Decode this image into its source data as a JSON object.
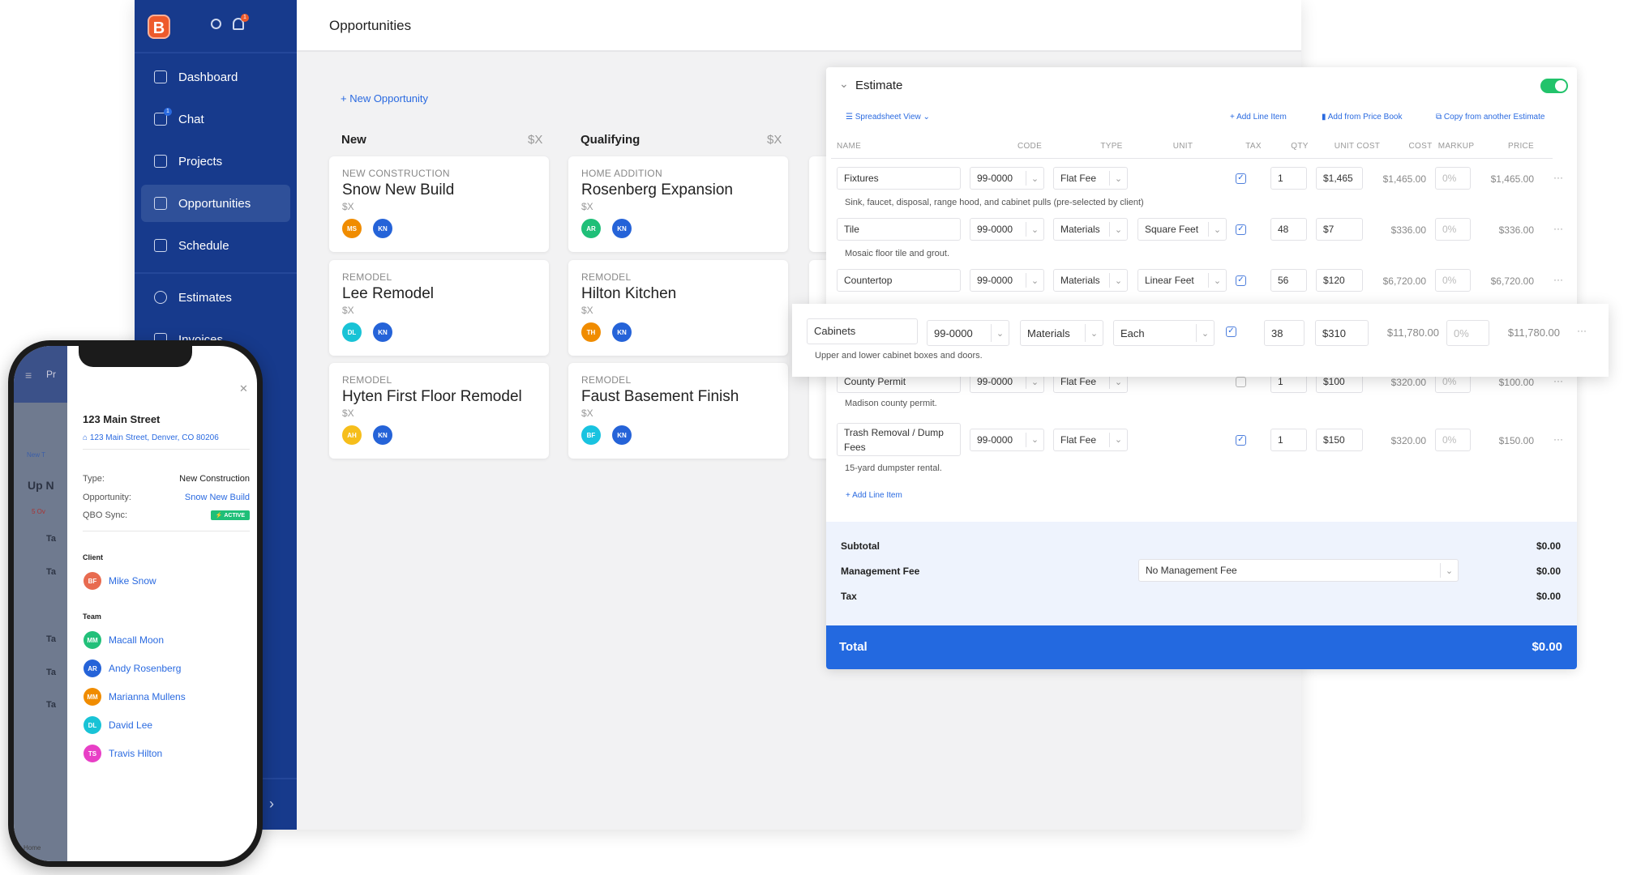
{
  "sidebar": {
    "logo": "B",
    "notif_count": "1",
    "chat_badge": "1",
    "items": [
      {
        "label": "Dashboard"
      },
      {
        "label": "Chat"
      },
      {
        "label": "Projects"
      },
      {
        "label": "Opportunities",
        "active": true
      },
      {
        "label": "Schedule"
      },
      {
        "label": "Estimates"
      },
      {
        "label": "Invoices"
      }
    ]
  },
  "header": {
    "title": "Opportunities"
  },
  "board": {
    "new_button": "+ New Opportunity",
    "columns": [
      {
        "title": "New",
        "sum": "$X",
        "cards": [
          {
            "category": "NEW CONSTRUCTION",
            "title": "Snow New Build",
            "amount": "$X",
            "avatars": [
              {
                "i": "MS",
                "c": "#f08c00"
              },
              {
                "i": "KN",
                "c": "#2563d8"
              }
            ]
          },
          {
            "category": "REMODEL",
            "title": "Lee Remodel",
            "amount": "$X",
            "avatars": [
              {
                "i": "DL",
                "c": "#19c3d6"
              },
              {
                "i": "KN",
                "c": "#2563d8"
              }
            ]
          },
          {
            "category": "REMODEL",
            "title": "Hyten First Floor Remodel",
            "amount": "$X",
            "avatars": [
              {
                "i": "AH",
                "c": "#f6be1b"
              },
              {
                "i": "KN",
                "c": "#2563d8"
              }
            ]
          }
        ]
      },
      {
        "title": "Qualifying",
        "sum": "$X",
        "cards": [
          {
            "category": "HOME ADDITION",
            "title": "Rosenberg Expansion",
            "amount": "$X",
            "avatars": [
              {
                "i": "AR",
                "c": "#1fbf78"
              },
              {
                "i": "KN",
                "c": "#2563d8"
              }
            ]
          },
          {
            "category": "REMODEL",
            "title": "Hilton Kitchen",
            "amount": "$X",
            "avatars": [
              {
                "i": "TH",
                "c": "#f08c00"
              },
              {
                "i": "KN",
                "c": "#2563d8"
              }
            ]
          },
          {
            "category": "REMODEL",
            "title": "Faust Basement Finish",
            "amount": "$X",
            "avatars": [
              {
                "i": "BF",
                "c": "#19c3e0"
              },
              {
                "i": "KN",
                "c": "#2563d8"
              }
            ]
          }
        ]
      }
    ]
  },
  "estimate": {
    "title": "Estimate",
    "toggle_on": true,
    "view": "Spreadsheet View",
    "add_line_item": "+ Add Line Item",
    "add_price_book": "Add from Price Book",
    "copy_estimate": "Copy from another Estimate",
    "headers": [
      "NAME",
      "CODE",
      "TYPE",
      "UNIT",
      "TAX",
      "QTY",
      "UNIT COST",
      "COST",
      "MARKUP",
      "PRICE"
    ],
    "rows": [
      {
        "name": "Fixtures",
        "code": "99-0000",
        "type": "Flat Fee",
        "unit": "",
        "tax": true,
        "qty": "1",
        "unit_cost": "$1,465",
        "cost": "$1,465.00",
        "markup": "0%",
        "price": "$1,465.00",
        "desc": "Sink, faucet, disposal, range hood, and cabinet pulls (pre-selected by client)"
      },
      {
        "name": "Tile",
        "code": "99-0000",
        "type": "Materials",
        "unit": "Square Feet",
        "tax": true,
        "qty": "48",
        "unit_cost": "$7",
        "cost": "$336.00",
        "markup": "0%",
        "price": "$336.00",
        "desc": "Mosaic floor tile and grout."
      },
      {
        "name": "Countertop",
        "code": "99-0000",
        "type": "Materials",
        "unit": "Linear Feet",
        "tax": true,
        "qty": "56",
        "unit_cost": "$120",
        "cost": "$6,720.00",
        "markup": "0%",
        "price": "$6,720.00",
        "desc": ""
      },
      {
        "name": "Cabinets",
        "code": "99-0000",
        "type": "Materials",
        "unit": "Each",
        "tax": true,
        "qty": "38",
        "unit_cost": "$310",
        "cost": "$11,780.00",
        "markup": "0%",
        "price": "$11,780.00",
        "desc": "Upper and lower cabinet boxes and doors."
      },
      {
        "name": "County Permit",
        "code": "99-0000",
        "type": "Flat Fee",
        "unit": "",
        "tax": false,
        "qty": "1",
        "unit_cost": "$100",
        "cost": "$320.00",
        "markup": "0%",
        "price": "$100.00",
        "desc": "Madison county permit."
      },
      {
        "name": "Trash Removal / Dump Fees",
        "code": "99-0000",
        "type": "Flat Fee",
        "unit": "",
        "tax": true,
        "qty": "1",
        "unit_cost": "$150",
        "cost": "$320.00",
        "markup": "0%",
        "price": "$150.00",
        "desc": "15-yard dumpster rental."
      }
    ],
    "add_line_item_bottom": "+ Add Line Item",
    "subtotal_label": "Subtotal",
    "subtotal": "$0.00",
    "mgmt_label": "Management Fee",
    "mgmt_select": "No Management Fee",
    "mgmt": "$0.00",
    "tax_label": "Tax",
    "tax": "$0.00",
    "total_label": "Total",
    "total": "$0.00",
    "colors": {
      "accent": "#2a6ae0",
      "total_bar": "#2369e0",
      "summary_bg": "#eef3fd",
      "toggle": "#22c36b"
    }
  },
  "phone": {
    "title": "123 Main Street",
    "address": "123 Main Street, Denver, CO 80206",
    "type_label": "Type:",
    "type": "New Construction",
    "opp_label": "Opportunity:",
    "opp": "Snow New Build",
    "qbo_label": "QBO Sync:",
    "qbo": "ACTIVE",
    "client_label": "Client",
    "client": {
      "i": "BF",
      "name": "Mike Snow",
      "c": "#e86b50"
    },
    "team_label": "Team",
    "team": [
      {
        "i": "MM",
        "name": "Macall Moon",
        "c": "#22c07a"
      },
      {
        "i": "AR",
        "name": "Andy Rosenberg",
        "c": "#2563d8"
      },
      {
        "i": "MM",
        "name": "Marianna Mullens",
        "c": "#f08c00"
      },
      {
        "i": "DL",
        "name": "David Lee",
        "c": "#19c3d6"
      },
      {
        "i": "TS",
        "name": "Travis Hilton",
        "c": "#e83fc6"
      }
    ],
    "bg": {
      "title_frag": "Pr",
      "new_frag": "New T",
      "upnext_frag": "Up N",
      "overdue_frag": "5  Ov",
      "task_frag": "Ta",
      "home": "Home"
    }
  }
}
